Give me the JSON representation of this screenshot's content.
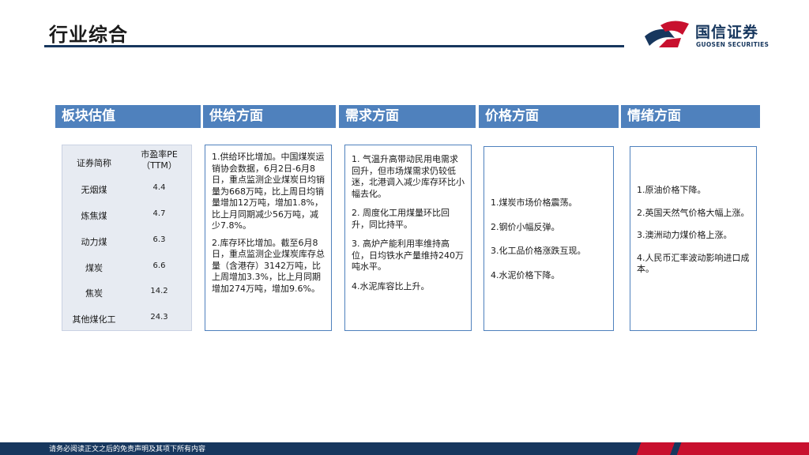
{
  "page": {
    "title": "行业综合",
    "footer": "请务必阅读正文之后的免责声明及其项下所有内容"
  },
  "brand": {
    "name_cn": "国信证券",
    "name_en": "GUOSEN SECURITIES",
    "colors": {
      "navy": "#17375e",
      "red": "#c8102e",
      "header_blue": "#4f81bd"
    }
  },
  "sections": {
    "valuation": "板块估值",
    "supply": "供给方面",
    "demand": "需求方面",
    "price": "价格方面",
    "sentiment": "情绪方面"
  },
  "valuation_table": {
    "col_name": "证券简称",
    "col_pe_line1": "市盈率PE",
    "col_pe_line2": "（TTM）",
    "rows": [
      {
        "name": "无烟煤",
        "pe": "4.4"
      },
      {
        "name": "炼焦煤",
        "pe": "4.7"
      },
      {
        "name": "动力煤",
        "pe": "6.3"
      },
      {
        "name": "煤炭",
        "pe": "6.6"
      },
      {
        "name": "焦炭",
        "pe": "14.2"
      },
      {
        "name": "其他煤化工",
        "pe": "24.3"
      }
    ]
  },
  "supply_box": {
    "p1": "1.供给环比增加。中国煤炭运销协会数据，6月2日-6月8日，重点监测企业煤炭日均销量为668万吨，比上周日均销量增加12万吨，增加1.8%，比上月同期减少56万吨，减少7.8%。",
    "p2": "2.库存环比增加。截至6月8日，重点监测企业煤炭库存总量（含港存）3142万吨，比上周增加3.3%，比上月同期增加274万吨，增加9.6%。"
  },
  "demand_box": {
    "p1": "1. 气温升高带动民用电需求回升，但市场煤需求仍较低迷，北港调入减少库存环比小幅去化。",
    "p2": "2. 周度化工用煤量环比回升，同比持平。",
    "p3": "3. 高炉产能利用率维持高位，日均铁水产量维持240万吨水平。",
    "p4": "4.水泥库容比上升。"
  },
  "price_box": {
    "p1": "1.煤炭市场价格震荡。",
    "p2": "2.钢价小幅反弹。",
    "p3": "3.化工品价格涨跌互现。",
    "p4": "4.水泥价格下降。"
  },
  "sentiment_box": {
    "p1": "1.原油价格下降。",
    "p2": "2.英国天然气价格大幅上涨。",
    "p3": "3.澳洲动力煤价格上涨。",
    "p4": "4.人民币汇率波动影响进口成本。"
  }
}
